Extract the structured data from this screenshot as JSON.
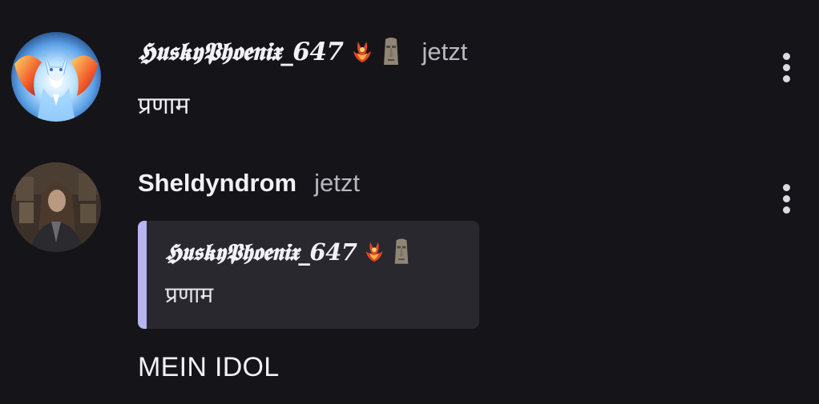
{
  "messages": [
    {
      "username": "𝕳𝖚𝖘𝖐𝖞𝕻𝖍𝖔𝖊𝖓𝖎𝖝_647",
      "badges": [
        "phoenix-emoji",
        "moai-emoji"
      ],
      "timestamp": "jetzt",
      "text": "प्रणाम"
    },
    {
      "username": "Sheldyndrom",
      "timestamp": "jetzt",
      "reply": {
        "username": "𝕳𝖚𝖘𝖐𝖞𝕻𝖍𝖔𝖊𝖓𝖎𝖝_647",
        "badges": [
          "phoenix-emoji",
          "moai-emoji"
        ],
        "text": "प्रणाम"
      },
      "text": "MEIN IDOL"
    }
  ],
  "colors": {
    "background": "#151418",
    "reply_background": "#29282f",
    "reply_accent": "#b8b5f3",
    "timestamp": "#b9b8c0"
  },
  "icons": {
    "more_menu": "more-vertical-icon"
  }
}
